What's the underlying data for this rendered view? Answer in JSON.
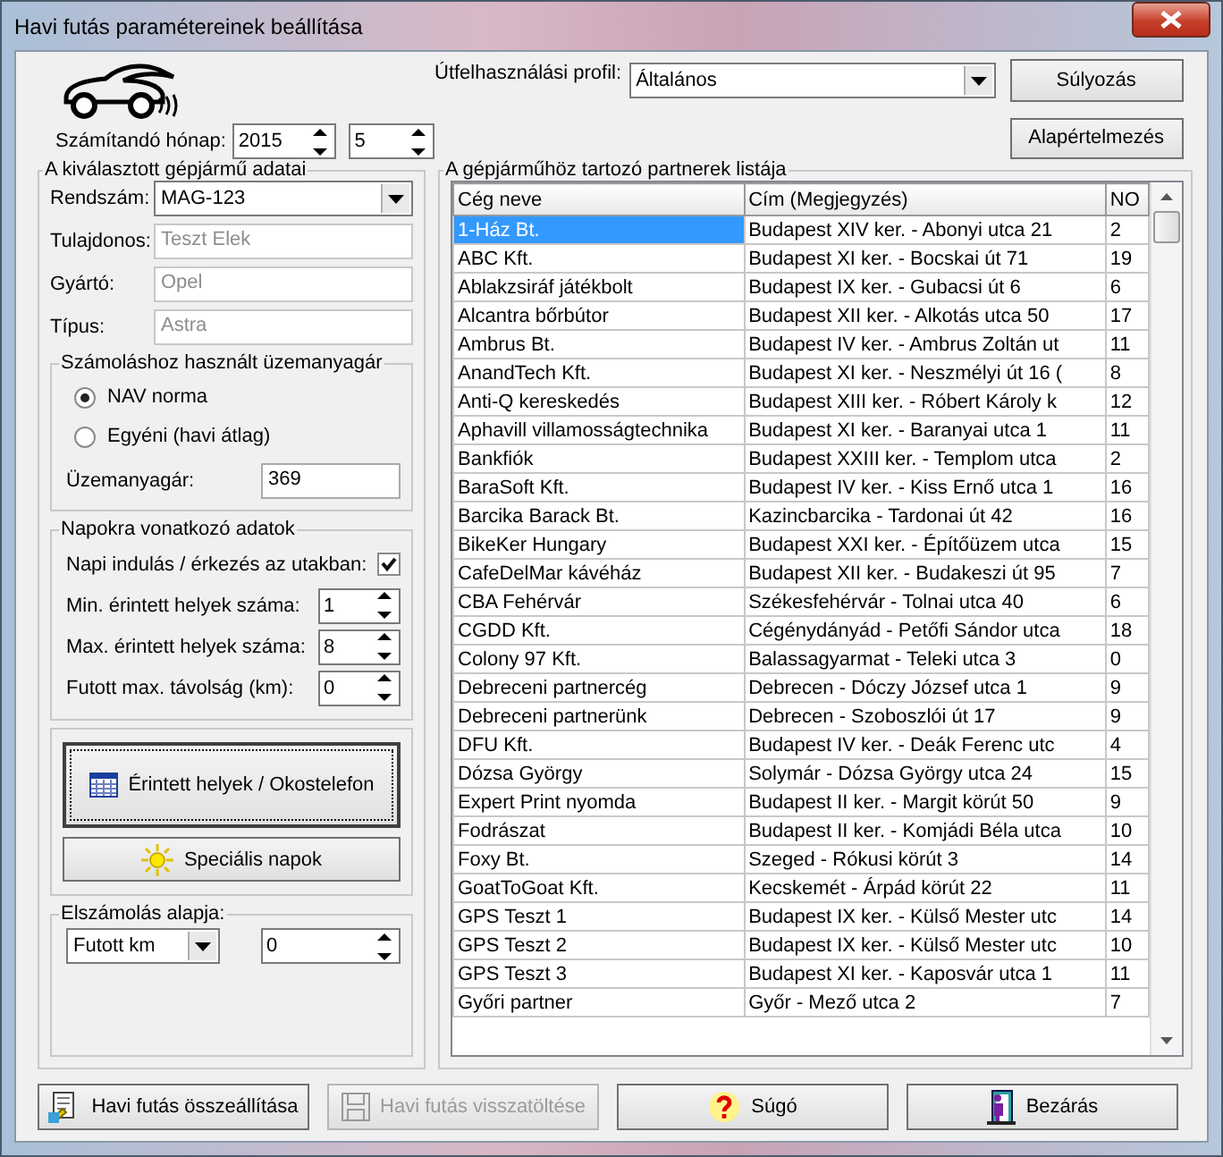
{
  "window": {
    "title": "Havi futás paramétereinek beállítása"
  },
  "header": {
    "month_label": "Számítandó hónap:",
    "year": "2015",
    "month": "5",
    "profile_label": "Útfelhasználási profil:",
    "profile": "Általános",
    "buttons": [
      "Súlyozás",
      "Alapértelmezés"
    ]
  },
  "vehicle": {
    "title": "A kiválasztott gépjármű adatai",
    "fields": [
      {
        "label": "Rendszám:",
        "value": "MAG-123",
        "kind": "dropdown",
        "disabled": false
      },
      {
        "label": "Tulajdonos:",
        "value": "Teszt Elek",
        "kind": "text",
        "disabled": true
      },
      {
        "label": "Gyártó:",
        "value": "Opel",
        "kind": "text",
        "disabled": true
      },
      {
        "label": "Típus:",
        "value": "Astra",
        "kind": "text",
        "disabled": true
      }
    ]
  },
  "fuel": {
    "title": "Számoláshoz használt üzemanyagár",
    "options": [
      {
        "label": "NAV norma",
        "selected": true
      },
      {
        "label": "Egyéni (havi átlag)",
        "selected": false
      }
    ],
    "price_label": "Üzemanyagár:",
    "price": "369"
  },
  "days": {
    "title": "Napokra vonatkozó adatok",
    "daily_label": "Napi indulás / érkezés az utakban:",
    "daily_checked": true,
    "spinners": [
      {
        "label": "Min. érintett helyek száma:",
        "value": "1"
      },
      {
        "label": "Max. érintett helyek száma:",
        "value": "8"
      },
      {
        "label": "Futott max. távolság (km):",
        "value": "0"
      }
    ]
  },
  "action_buttons": [
    {
      "label": "Érintett helyek / Okostelefon",
      "kind": "calendar",
      "focused": true
    },
    {
      "label": "Speciális napok",
      "kind": "sun",
      "focused": false
    }
  ],
  "billing": {
    "title": "Elszámolás alapja:",
    "basis": "Futott km",
    "value": "0"
  },
  "partners": {
    "title": "A gépjárműhöz tartozó partnerek listája",
    "columns": [
      "Cég neve",
      "Cím (Megjegyzés)",
      "NO"
    ],
    "rows": [
      {
        "cells": [
          "1-Ház Bt.",
          "Budapest XIV ker. - Abonyi utca 21",
          "2"
        ],
        "selected": true
      },
      {
        "cells": [
          "ABC Kft.",
          "Budapest XI ker. - Bocskai út 71",
          "19"
        ],
        "selected": false
      },
      {
        "cells": [
          "Ablakzsiráf játékbolt",
          "Budapest IX ker. - Gubacsi út 6",
          "6"
        ],
        "selected": false
      },
      {
        "cells": [
          "Alcantra bőrbútor",
          "Budapest XII ker. - Alkotás utca 50",
          "17"
        ],
        "selected": false
      },
      {
        "cells": [
          "Ambrus Bt.",
          "Budapest IV ker. - Ambrus Zoltán ut",
          "11"
        ],
        "selected": false
      },
      {
        "cells": [
          "AnandTech Kft.",
          "Budapest XI ker. - Neszmélyi út 16 (",
          "8"
        ],
        "selected": false
      },
      {
        "cells": [
          "Anti-Q kereskedés",
          "Budapest XIII ker. - Róbert Károly k",
          "12"
        ],
        "selected": false
      },
      {
        "cells": [
          "Aphavill villamosságtechnika",
          "Budapest XI ker. - Baranyai utca 1",
          "11"
        ],
        "selected": false
      },
      {
        "cells": [
          "Bankfiók",
          "Budapest XXIII ker. - Templom utca",
          "2"
        ],
        "selected": false
      },
      {
        "cells": [
          "BaraSoft Kft.",
          "Budapest IV ker. - Kiss Ernő utca 1",
          "16"
        ],
        "selected": false
      },
      {
        "cells": [
          "Barcika Barack Bt.",
          "Kazincbarcika - Tardonai út 42",
          "16"
        ],
        "selected": false
      },
      {
        "cells": [
          "BikeKer Hungary",
          "Budapest XXI ker. - Építőüzem utca",
          "15"
        ],
        "selected": false
      },
      {
        "cells": [
          "CafeDelMar kávéház",
          "Budapest XII ker. - Budakeszi út 95",
          "7"
        ],
        "selected": false
      },
      {
        "cells": [
          "CBA Fehérvár",
          "Székesfehérvár - Tolnai utca 40",
          "6"
        ],
        "selected": false
      },
      {
        "cells": [
          "CGDD Kft.",
          "Cégénydányád - Petőfi Sándor utca",
          "18"
        ],
        "selected": false
      },
      {
        "cells": [
          "Colony 97 Kft.",
          "Balassagyarmat - Teleki utca 3",
          "0"
        ],
        "selected": false
      },
      {
        "cells": [
          "Debreceni partnercég",
          "Debrecen - Dóczy József utca 1",
          "9"
        ],
        "selected": false
      },
      {
        "cells": [
          "Debreceni partnerünk",
          "Debrecen - Szoboszlói út 17",
          "9"
        ],
        "selected": false
      },
      {
        "cells": [
          "DFU Kft.",
          "Budapest IV ker. - Deák Ferenc utc",
          "4"
        ],
        "selected": false
      },
      {
        "cells": [
          "Dózsa György",
          "Solymár - Dózsa György utca 24",
          "15"
        ],
        "selected": false
      },
      {
        "cells": [
          "Expert Print nyomda",
          "Budapest II ker. - Margit körút 50",
          "9"
        ],
        "selected": false
      },
      {
        "cells": [
          "Fodrászat",
          "Budapest II ker. - Komjádi Béla utca",
          "10"
        ],
        "selected": false
      },
      {
        "cells": [
          "Foxy Bt.",
          "Szeged - Rókusi körút 3",
          "14"
        ],
        "selected": false
      },
      {
        "cells": [
          "GoatToGoat Kft.",
          "Kecskemét - Árpád körút 22",
          "11"
        ],
        "selected": false
      },
      {
        "cells": [
          "GPS Teszt 1",
          "Budapest IX ker. - Külső Mester utc",
          "14"
        ],
        "selected": false
      },
      {
        "cells": [
          "GPS Teszt 2",
          "Budapest IX ker. - Külső Mester utc",
          "10"
        ],
        "selected": false
      },
      {
        "cells": [
          "GPS Teszt 3",
          "Budapest XI ker. - Kaposvár utca 1",
          "11"
        ],
        "selected": false
      },
      {
        "cells": [
          "Győri partner",
          "Győr - Mező utca 2",
          "7"
        ],
        "selected": false
      }
    ]
  },
  "footer_buttons": [
    {
      "label": "Havi futás összeállítása",
      "kind": "compose",
      "disabled": false
    },
    {
      "label": "Havi futás visszatöltése",
      "kind": "disk",
      "disabled": true
    },
    {
      "label": "Súgó",
      "kind": "help",
      "disabled": false
    },
    {
      "label": "Bezárás",
      "kind": "exit",
      "disabled": false
    }
  ]
}
